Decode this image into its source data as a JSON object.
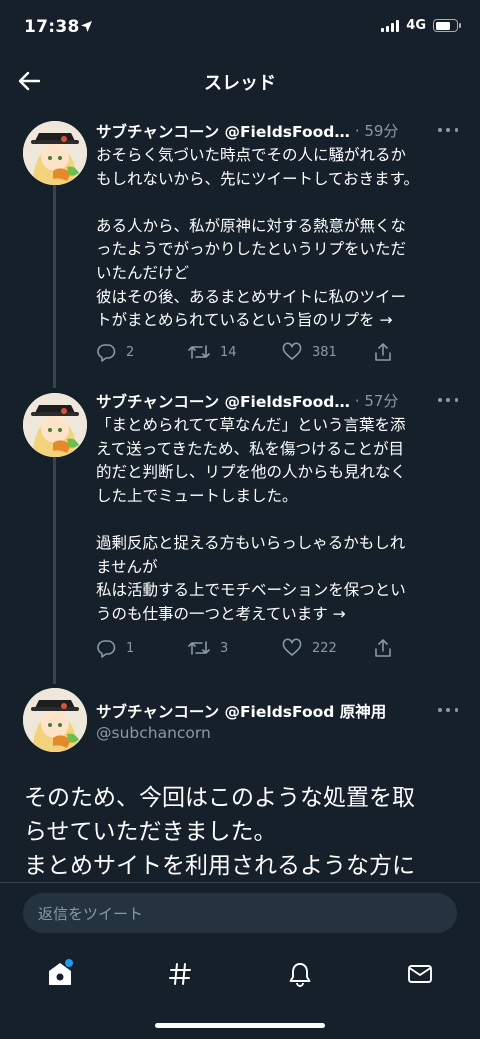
{
  "status_bar": {
    "time": "17:38",
    "network": "4G"
  },
  "header": {
    "title": "スレッド"
  },
  "tweets": [
    {
      "name": "サブチャンコーン @FieldsFood…",
      "time": "· 59分",
      "text": "おそらく気づいた時点でその人に騒がれるか\nもしれないから、先にツイートしておきます。\n\nある人から、私が原神に対する熱意が無くな\nったようでがっかりしたというリプをいただ\nいたんだけど\n彼はその後、あるまとめサイトに私のツイー\nトがまとめられているという旨のリプを →",
      "replies": "2",
      "retweets": "14",
      "likes": "381"
    },
    {
      "name": "サブチャンコーン @FieldsFood…",
      "time": "· 57分",
      "text": "「まとめられてて草なんだ」という言葉を添\nえて送ってきたため、私を傷つけることが目\n的だと判断し、リプを他の人からも見れなく\nした上でミュートしました。\n\n過剰反応と捉える方もいらっしゃるかもしれ\nませんが\n私は活動する上でモチベーションを保つとい\nうのも仕事の一つと考えています →",
      "replies": "1",
      "retweets": "3",
      "likes": "222"
    }
  ],
  "main_tweet": {
    "name": "サブチャンコーン @FieldsFood 原神用",
    "handle": "@subchancorn",
    "text": "そのため、今回はこのような処置を取\nらせていただきました。\nまとめサイトを利用されるような方に"
  },
  "reply_bar": {
    "placeholder": "返信をツイート"
  },
  "tabs": [
    "home-icon",
    "explore-hash-icon",
    "notifications-bell-icon",
    "messages-envelope-icon"
  ],
  "colors": {
    "background": "#15202b",
    "accent": "#1d9bf0",
    "muted": "#8899a6"
  }
}
